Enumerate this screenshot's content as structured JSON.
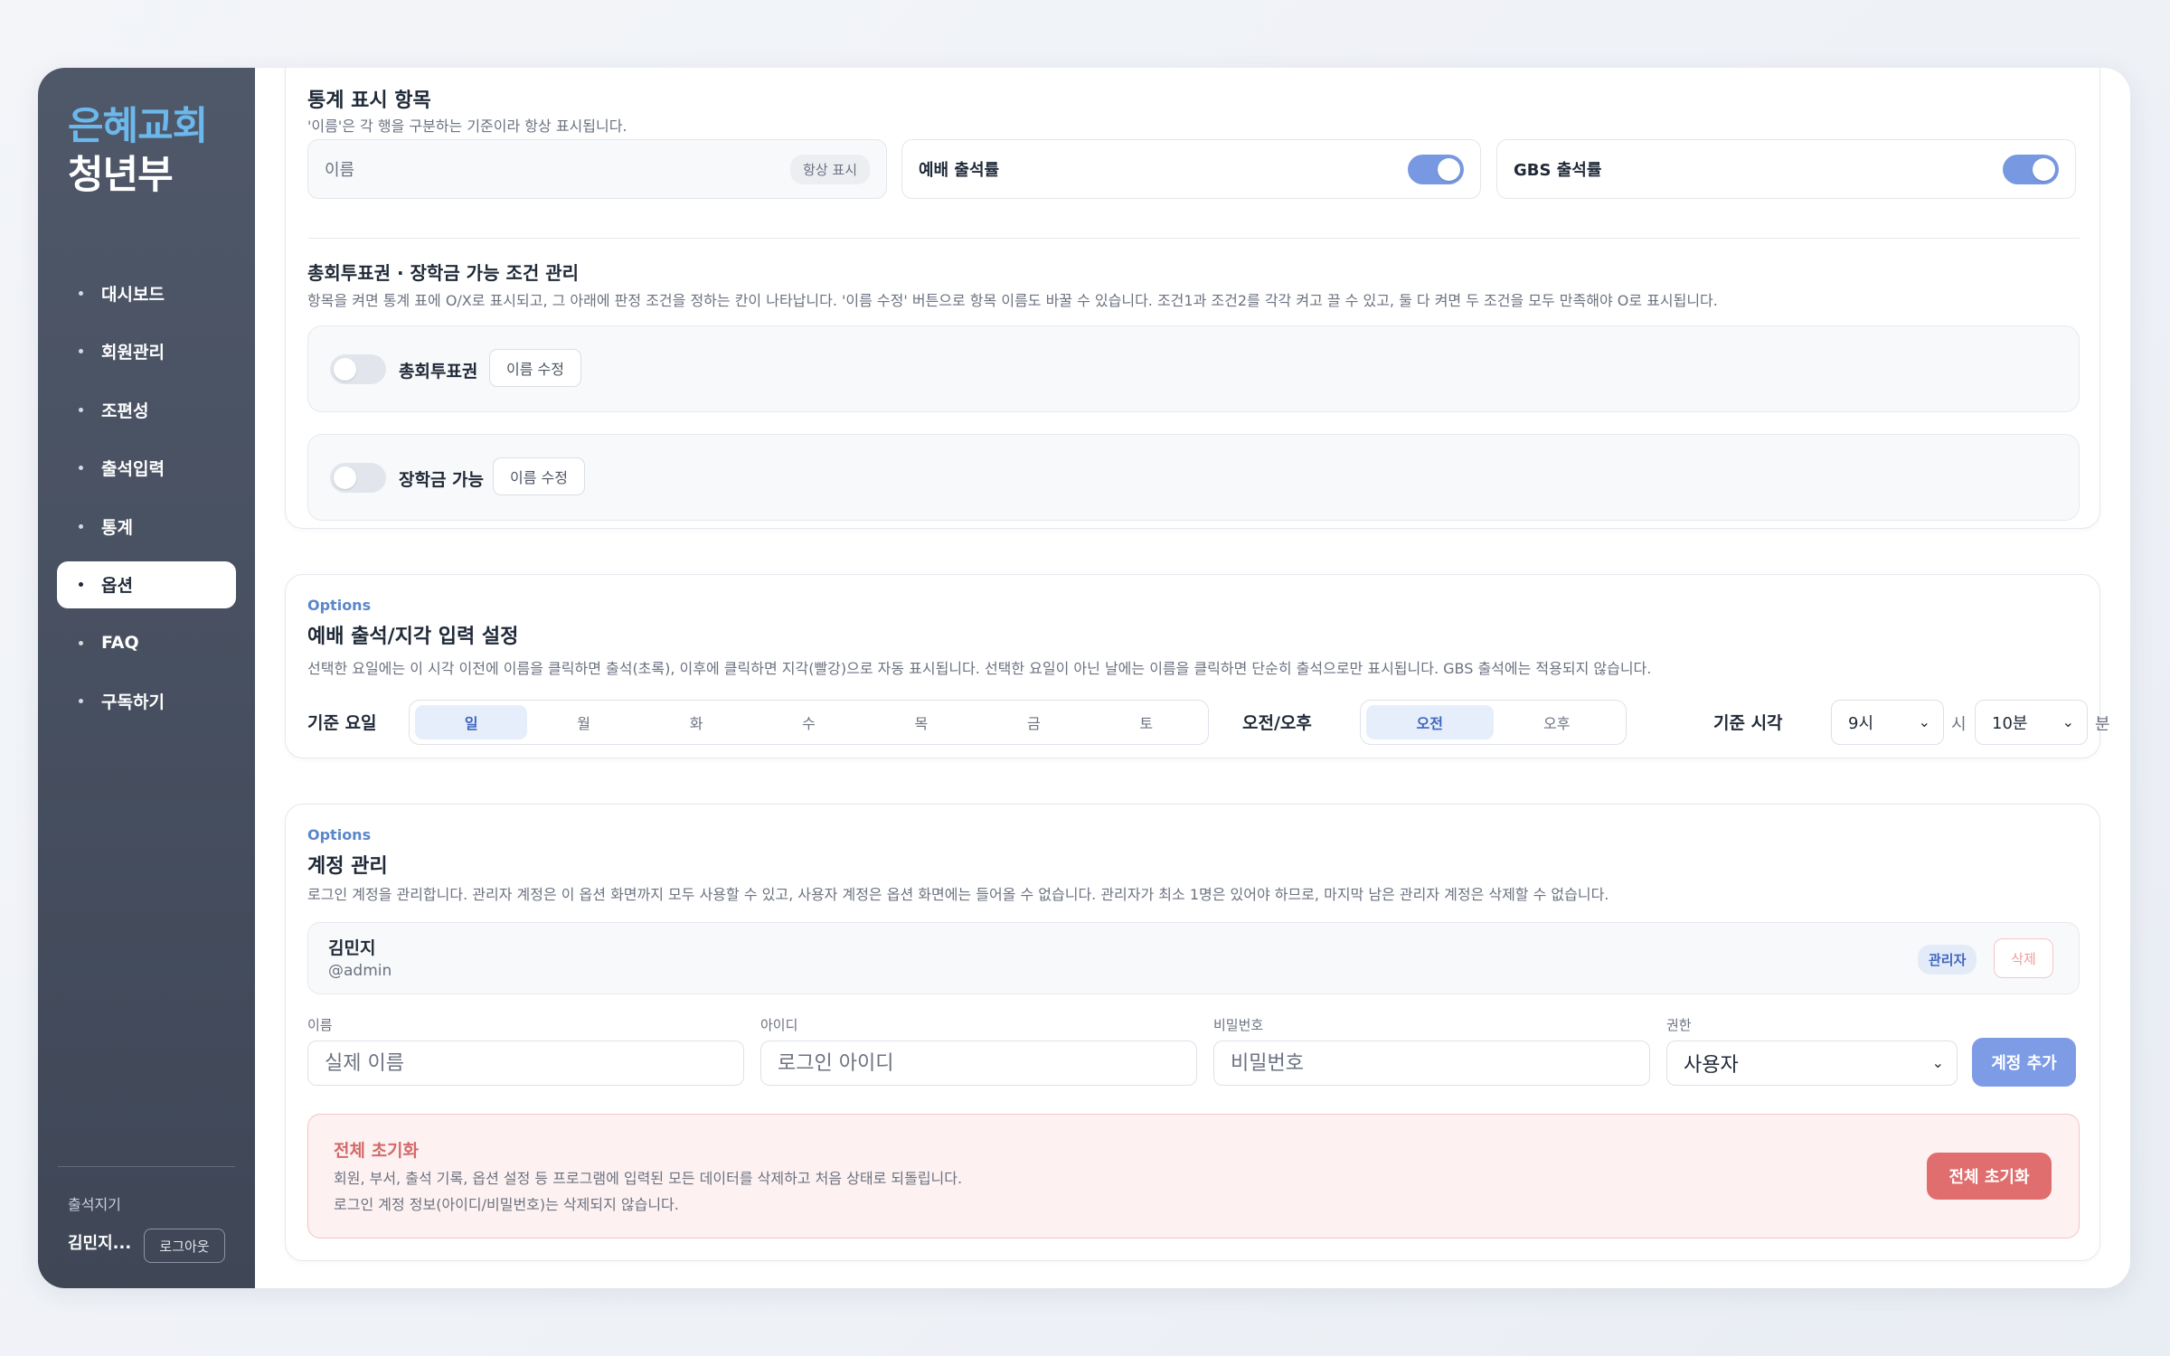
{
  "sidebar": {
    "brand_line1": "은혜교회",
    "brand_line2": "청년부",
    "items": [
      {
        "label": "대시보드"
      },
      {
        "label": "회원관리"
      },
      {
        "label": "조편성"
      },
      {
        "label": "출석입력"
      },
      {
        "label": "통계"
      },
      {
        "label": "옵션",
        "active": true
      },
      {
        "label": "FAQ"
      },
      {
        "label": "구독하기"
      }
    ],
    "section_label": "출석지기",
    "user_name": "김민지...",
    "logout_label": "로그아웃"
  },
  "stats_card": {
    "title": "통계 표시 항목",
    "desc": "'이름'은 각 행을 구분하는 기준이라 항상 표시됩니다.",
    "fields": {
      "name_label": "이름",
      "always_badge": "항상 표시",
      "worship_label": "예배 출석률",
      "worship_on": true,
      "gbs_label": "GBS 출석률",
      "gbs_on": true
    },
    "conditions_title": "총회투표권 · 장학금 가능 조건 관리",
    "conditions_desc": "항목을 켜면 통계 표에 O/X로 표시되고, 그 아래에 판정 조건을 정하는 칸이 나타납니다. '이름 수정' 버튼으로 항목 이름도 바꿀 수 있습니다. 조건1과 조건2를 각각 켜고 끌 수 있고, 둘 다 켜면 두 조건을 모두 만족해야 O로 표시됩니다.",
    "vote_label": "총회투표권",
    "vote_on": false,
    "scholar_label": "장학금 가능",
    "scholar_on": false,
    "rename_label": "이름 수정"
  },
  "attendance_card": {
    "eyebrow": "Options",
    "title": "예배 출석/지각 입력 설정",
    "desc": "선택한 요일에는 이 시각 이전에 이름을 클릭하면 출석(초록), 이후에 클릭하면 지각(빨강)으로 자동 표시됩니다. 선택한 요일이 아닌 날에는 이름을 클릭하면 단순히 출석으로만 표시됩니다. GBS 출석에는 적용되지 않습니다.",
    "day_label": "기준 요일",
    "days": [
      "일",
      "월",
      "화",
      "수",
      "목",
      "금",
      "토"
    ],
    "selected_day": "일",
    "ampm_label": "오전/오후",
    "ampm": [
      "오전",
      "오후"
    ],
    "selected_ampm": "오전",
    "time_label": "기준 시각",
    "hour_value": "9시",
    "hour_unit": "시",
    "minute_value": "10분",
    "minute_unit": "분"
  },
  "account_card": {
    "eyebrow": "Options",
    "title": "계정 관리",
    "desc": "로그인 계정을 관리합니다. 관리자 계정은 이 옵션 화면까지 모두 사용할 수 있고, 사용자 계정은 옵션 화면에는 들어올 수 없습니다. 관리자가 최소 1명은 있어야 하므로, 마지막 남은 관리자 계정은 삭제할 수 없습니다.",
    "account": {
      "name": "김민지",
      "id": "@admin",
      "role_badge": "관리자",
      "delete_label": "삭제"
    },
    "form": {
      "name_label": "이름",
      "name_placeholder": "실제 이름",
      "id_label": "아이디",
      "id_placeholder": "로그인 아이디",
      "pw_label": "비밀번호",
      "pw_placeholder": "비밀번호",
      "role_label": "권한",
      "role_value": "사용자",
      "add_label": "계정 추가"
    },
    "reset": {
      "title": "전체 초기화",
      "line1": "회원, 부서, 출석 기록, 옵션 설정 등 프로그램에 입력된 모든 데이터를 삭제하고 처음 상태로 되돌립니다.",
      "line2": "로그인 계정 정보(아이디/비밀번호)는 삭제되지 않습니다.",
      "button": "전체 초기화"
    }
  },
  "colors": {
    "accent": "#7898e2",
    "sidebar_bg": "#4a5263",
    "danger": "#e36d6d",
    "danger_bg": "#fdf1f1"
  }
}
